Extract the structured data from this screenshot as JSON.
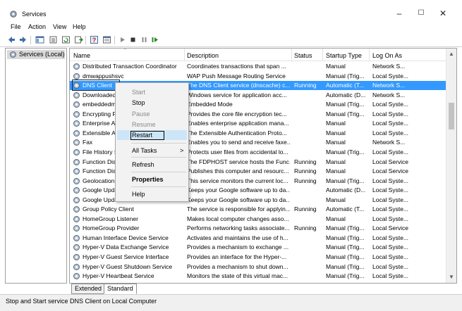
{
  "window": {
    "title": "Services",
    "controls": {
      "minimize": "–",
      "maximize": "☐",
      "close": "✕"
    }
  },
  "menu": [
    "File",
    "Action",
    "View",
    "Help"
  ],
  "toolbar_icons": [
    "back-arrow-icon",
    "forward-arrow-icon",
    "console-tree-icon",
    "properties-icon",
    "refresh-icon",
    "export-icon",
    "help-icon",
    "view-icon",
    "play-icon",
    "stop-icon",
    "pause-icon",
    "resume-icon"
  ],
  "tree": {
    "root_label": "Services (Local)"
  },
  "columns": [
    "Name",
    "Description",
    "Status",
    "Startup Type",
    "Log On As"
  ],
  "rows": [
    {
      "name": "Distributed Transaction Coordinator",
      "desc": "Coordinates transactions that span ...",
      "status": "",
      "startup": "Manual",
      "logon": "Network S..."
    },
    {
      "name": "dmwappushsvc",
      "desc": "WAP Push Message Routing Service",
      "status": "",
      "startup": "Manual (Trig...",
      "logon": "Local Syste..."
    },
    {
      "name": "DNS Client",
      "desc": "The DNS Client service (dnscache) c...",
      "status": "Running",
      "startup": "Automatic (T...",
      "logon": "Network S...",
      "selected": true
    },
    {
      "name": "Downloaded",
      "desc": "Windows service for application acc...",
      "status": "",
      "startup": "Automatic (D...",
      "logon": "Network S..."
    },
    {
      "name": "embeddedm",
      "desc": "Embedded Mode",
      "status": "",
      "startup": "Manual (Trig...",
      "logon": "Local Syste..."
    },
    {
      "name": "Encrypting F",
      "desc": "Provides the core file encryption tec...",
      "status": "",
      "startup": "Manual (Trig...",
      "logon": "Local Syste..."
    },
    {
      "name": "Enterprise Ap",
      "desc": "Enables enterprise application mana...",
      "status": "",
      "startup": "Manual",
      "logon": "Local Syste..."
    },
    {
      "name": "Extensible Au",
      "desc": "The Extensible Authentication Proto...",
      "status": "",
      "startup": "Manual",
      "logon": "Local Syste..."
    },
    {
      "name": "Fax",
      "desc": "Enables you to send and receive faxe...",
      "status": "",
      "startup": "Manual",
      "logon": "Network S..."
    },
    {
      "name": "File History S",
      "desc": "Protects user files from accidental lo...",
      "status": "",
      "startup": "Manual (Trig...",
      "logon": "Local Syste..."
    },
    {
      "name": "Function Dis",
      "desc": "The FDPHOST service hosts the Func...",
      "status": "Running",
      "startup": "Manual",
      "logon": "Local Service"
    },
    {
      "name": "Function Dis",
      "desc": "Publishes this computer and resourc...",
      "status": "Running",
      "startup": "Manual",
      "logon": "Local Service"
    },
    {
      "name": "Geolocation",
      "desc": "This service monitors the current loc...",
      "status": "Running",
      "startup": "Manual (Trig...",
      "logon": "Local Syste..."
    },
    {
      "name": "Google Upda",
      "desc": "Keeps your Google software up to da...",
      "status": "",
      "startup": "Automatic (D...",
      "logon": "Local Syste..."
    },
    {
      "name": "Google Upda",
      "desc": "Keeps your Google software up to da...",
      "status": "",
      "startup": "Manual",
      "logon": "Local Syste..."
    },
    {
      "name": "Group Policy Client",
      "desc": "The service is responsible for applyin...",
      "status": "Running",
      "startup": "Automatic (T...",
      "logon": "Local Syste..."
    },
    {
      "name": "HomeGroup Listener",
      "desc": "Makes local computer changes asso...",
      "status": "",
      "startup": "Manual",
      "logon": "Local Syste..."
    },
    {
      "name": "HomeGroup Provider",
      "desc": "Performs networking tasks associate...",
      "status": "Running",
      "startup": "Manual (Trig...",
      "logon": "Local Service"
    },
    {
      "name": "Human Interface Device Service",
      "desc": "Activates and maintains the use of h...",
      "status": "",
      "startup": "Manual (Trig...",
      "logon": "Local Syste..."
    },
    {
      "name": "Hyper-V Data Exchange Service",
      "desc": "Provides a mechanism to exchange ...",
      "status": "",
      "startup": "Manual (Trig...",
      "logon": "Local Syste..."
    },
    {
      "name": "Hyper-V Guest Service Interface",
      "desc": "Provides an interface for the Hyper-...",
      "status": "",
      "startup": "Manual (Trig...",
      "logon": "Local Syste..."
    },
    {
      "name": "Hyper-V Guest Shutdown Service",
      "desc": "Provides a mechanism to shut down...",
      "status": "",
      "startup": "Manual (Trig...",
      "logon": "Local Syste..."
    },
    {
      "name": "Hyper-V Heartbeat Service",
      "desc": "Monitors the state of this virtual mac...",
      "status": "",
      "startup": "Manual (Trig...",
      "logon": "Local Syste..."
    }
  ],
  "context_menu": {
    "start": "Start",
    "stop": "Stop",
    "pause": "Pause",
    "resume": "Resume",
    "restart": "Restart",
    "all_tasks": "All Tasks",
    "refresh": "Refresh",
    "properties": "Properties",
    "help": "Help",
    "submenu_arrow": ">"
  },
  "tabs": {
    "extended": "Extended",
    "standard": "Standard"
  },
  "status_text": "Stop and Start service DNS Client on Local Computer",
  "colors": {
    "selection": "#3399ff",
    "menu_highlight": "#cde6f7"
  }
}
